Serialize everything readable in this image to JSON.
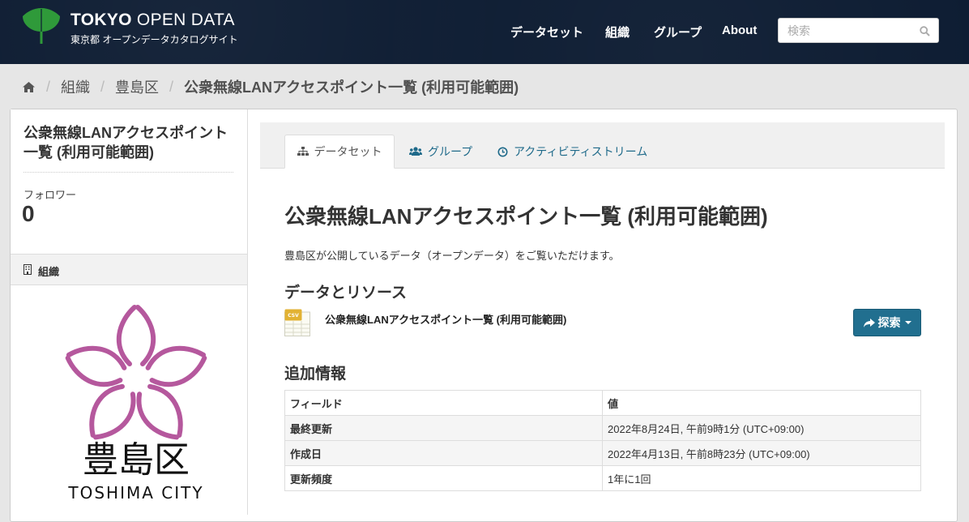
{
  "header": {
    "title_bold": "TOKYO",
    "title_rest": " OPEN DATA",
    "subtitle": "東京都 オープンデータカタログサイト",
    "nav": [
      "データセット",
      "組織",
      "グループ",
      "About"
    ],
    "search": {
      "placeholder": "検索"
    },
    "logo_icon": "ginkgo-leaf-icon",
    "logo_color": "#2f9a3a"
  },
  "breadcrumb": {
    "items": [
      "組織",
      "豊島区"
    ],
    "current": "公衆無線LANアクセスポイント一覧 (利用可能範囲)"
  },
  "sidebar": {
    "title": "公衆無線LANアクセスポイント一覧 (利用可能範囲)",
    "follower_label": "フォロワー",
    "follower_count": "0",
    "org_section_label": "組織",
    "org_logo": {
      "name_ja": "豊島区",
      "name_en": "TOSHIMA CITY",
      "color": "#b5589d"
    }
  },
  "tabs": [
    "データセット",
    "グループ",
    "アクティビティストリーム"
  ],
  "dataset": {
    "title": "公衆無線LANアクセスポイント一覧 (利用可能範囲)",
    "notes": "豊島区が公開しているデータ（オープンデータ）をご覧いただけます。",
    "resources_heading": "データとリソース",
    "resource": {
      "format": "CSV",
      "name": "公衆無線LANアクセスポイント一覧 (利用可能範囲)",
      "explore_label": "探索"
    },
    "additional_heading": "追加情報",
    "table": {
      "headers": [
        "フィールド",
        "値"
      ],
      "rows": [
        {
          "field": "最終更新",
          "value": "2022年8月24日, 午前9時1分 (UTC+09:00)"
        },
        {
          "field": "作成日",
          "value": "2022年4月13日, 午前8時23分 (UTC+09:00)"
        },
        {
          "field": "更新頻度",
          "value": "1年に1回"
        }
      ]
    }
  },
  "colors": {
    "masthead": "#0e1d33",
    "link": "#1f6a8a",
    "button": "#216f8f"
  }
}
